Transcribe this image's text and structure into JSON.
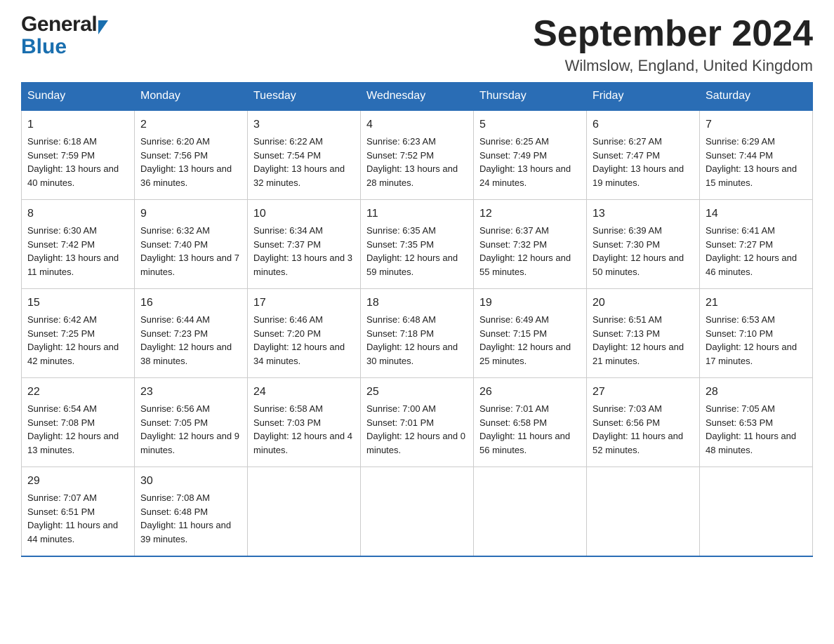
{
  "header": {
    "month_title": "September 2024",
    "location": "Wilmslow, England, United Kingdom",
    "logo_general": "General",
    "logo_blue": "Blue"
  },
  "weekdays": [
    "Sunday",
    "Monday",
    "Tuesday",
    "Wednesday",
    "Thursday",
    "Friday",
    "Saturday"
  ],
  "weeks": [
    [
      {
        "day": "1",
        "sunrise": "6:18 AM",
        "sunset": "7:59 PM",
        "daylight": "13 hours and 40 minutes."
      },
      {
        "day": "2",
        "sunrise": "6:20 AM",
        "sunset": "7:56 PM",
        "daylight": "13 hours and 36 minutes."
      },
      {
        "day": "3",
        "sunrise": "6:22 AM",
        "sunset": "7:54 PM",
        "daylight": "13 hours and 32 minutes."
      },
      {
        "day": "4",
        "sunrise": "6:23 AM",
        "sunset": "7:52 PM",
        "daylight": "13 hours and 28 minutes."
      },
      {
        "day": "5",
        "sunrise": "6:25 AM",
        "sunset": "7:49 PM",
        "daylight": "13 hours and 24 minutes."
      },
      {
        "day": "6",
        "sunrise": "6:27 AM",
        "sunset": "7:47 PM",
        "daylight": "13 hours and 19 minutes."
      },
      {
        "day": "7",
        "sunrise": "6:29 AM",
        "sunset": "7:44 PM",
        "daylight": "13 hours and 15 minutes."
      }
    ],
    [
      {
        "day": "8",
        "sunrise": "6:30 AM",
        "sunset": "7:42 PM",
        "daylight": "13 hours and 11 minutes."
      },
      {
        "day": "9",
        "sunrise": "6:32 AM",
        "sunset": "7:40 PM",
        "daylight": "13 hours and 7 minutes."
      },
      {
        "day": "10",
        "sunrise": "6:34 AM",
        "sunset": "7:37 PM",
        "daylight": "13 hours and 3 minutes."
      },
      {
        "day": "11",
        "sunrise": "6:35 AM",
        "sunset": "7:35 PM",
        "daylight": "12 hours and 59 minutes."
      },
      {
        "day": "12",
        "sunrise": "6:37 AM",
        "sunset": "7:32 PM",
        "daylight": "12 hours and 55 minutes."
      },
      {
        "day": "13",
        "sunrise": "6:39 AM",
        "sunset": "7:30 PM",
        "daylight": "12 hours and 50 minutes."
      },
      {
        "day": "14",
        "sunrise": "6:41 AM",
        "sunset": "7:27 PM",
        "daylight": "12 hours and 46 minutes."
      }
    ],
    [
      {
        "day": "15",
        "sunrise": "6:42 AM",
        "sunset": "7:25 PM",
        "daylight": "12 hours and 42 minutes."
      },
      {
        "day": "16",
        "sunrise": "6:44 AM",
        "sunset": "7:23 PM",
        "daylight": "12 hours and 38 minutes."
      },
      {
        "day": "17",
        "sunrise": "6:46 AM",
        "sunset": "7:20 PM",
        "daylight": "12 hours and 34 minutes."
      },
      {
        "day": "18",
        "sunrise": "6:48 AM",
        "sunset": "7:18 PM",
        "daylight": "12 hours and 30 minutes."
      },
      {
        "day": "19",
        "sunrise": "6:49 AM",
        "sunset": "7:15 PM",
        "daylight": "12 hours and 25 minutes."
      },
      {
        "day": "20",
        "sunrise": "6:51 AM",
        "sunset": "7:13 PM",
        "daylight": "12 hours and 21 minutes."
      },
      {
        "day": "21",
        "sunrise": "6:53 AM",
        "sunset": "7:10 PM",
        "daylight": "12 hours and 17 minutes."
      }
    ],
    [
      {
        "day": "22",
        "sunrise": "6:54 AM",
        "sunset": "7:08 PM",
        "daylight": "12 hours and 13 minutes."
      },
      {
        "day": "23",
        "sunrise": "6:56 AM",
        "sunset": "7:05 PM",
        "daylight": "12 hours and 9 minutes."
      },
      {
        "day": "24",
        "sunrise": "6:58 AM",
        "sunset": "7:03 PM",
        "daylight": "12 hours and 4 minutes."
      },
      {
        "day": "25",
        "sunrise": "7:00 AM",
        "sunset": "7:01 PM",
        "daylight": "12 hours and 0 minutes."
      },
      {
        "day": "26",
        "sunrise": "7:01 AM",
        "sunset": "6:58 PM",
        "daylight": "11 hours and 56 minutes."
      },
      {
        "day": "27",
        "sunrise": "7:03 AM",
        "sunset": "6:56 PM",
        "daylight": "11 hours and 52 minutes."
      },
      {
        "day": "28",
        "sunrise": "7:05 AM",
        "sunset": "6:53 PM",
        "daylight": "11 hours and 48 minutes."
      }
    ],
    [
      {
        "day": "29",
        "sunrise": "7:07 AM",
        "sunset": "6:51 PM",
        "daylight": "11 hours and 44 minutes."
      },
      {
        "day": "30",
        "sunrise": "7:08 AM",
        "sunset": "6:48 PM",
        "daylight": "11 hours and 39 minutes."
      },
      null,
      null,
      null,
      null,
      null
    ]
  ],
  "labels": {
    "sunrise_prefix": "Sunrise: ",
    "sunset_prefix": "Sunset: ",
    "daylight_prefix": "Daylight: "
  }
}
